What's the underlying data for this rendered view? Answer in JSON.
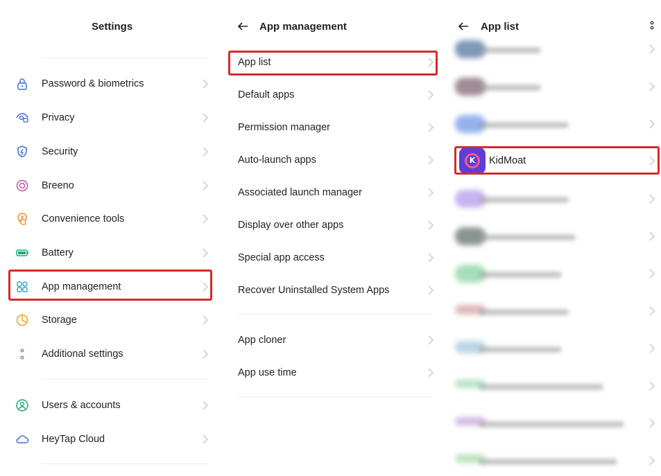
{
  "settings": {
    "title": "Settings",
    "group1": [
      {
        "label": "Password & biometrics",
        "icon": "lock-icon"
      },
      {
        "label": "Privacy",
        "icon": "privacy-eye-icon"
      },
      {
        "label": "Security",
        "icon": "shield-icon"
      },
      {
        "label": "Breeno",
        "icon": "breeno-icon"
      },
      {
        "label": "Convenience tools",
        "icon": "hand-touch-icon"
      },
      {
        "label": "Battery",
        "icon": "battery-icon"
      },
      {
        "label": "App management",
        "icon": "apps-grid-icon"
      },
      {
        "label": "Storage",
        "icon": "pie-chart-icon"
      },
      {
        "label": "Additional settings",
        "icon": "dots-vertical-icon"
      }
    ],
    "group2": [
      {
        "label": "Users & accounts",
        "icon": "user-icon"
      },
      {
        "label": "HeyTap Cloud",
        "icon": "cloud-icon"
      }
    ]
  },
  "app_management": {
    "title": "App management",
    "group1": [
      "App list",
      "Default apps",
      "Permission manager",
      "Auto-launch apps",
      "Associated launch manager",
      "Display over other apps",
      "Special app access",
      "Recover Uninstalled System Apps"
    ],
    "group2": [
      "App cloner",
      "App use time"
    ]
  },
  "app_list": {
    "title": "App list",
    "highlighted_app": "KidMoat"
  },
  "colors": {
    "highlight": "#d32b2b",
    "icon_blue": "#3e6fd8",
    "chevron": "#c4c4c4"
  }
}
